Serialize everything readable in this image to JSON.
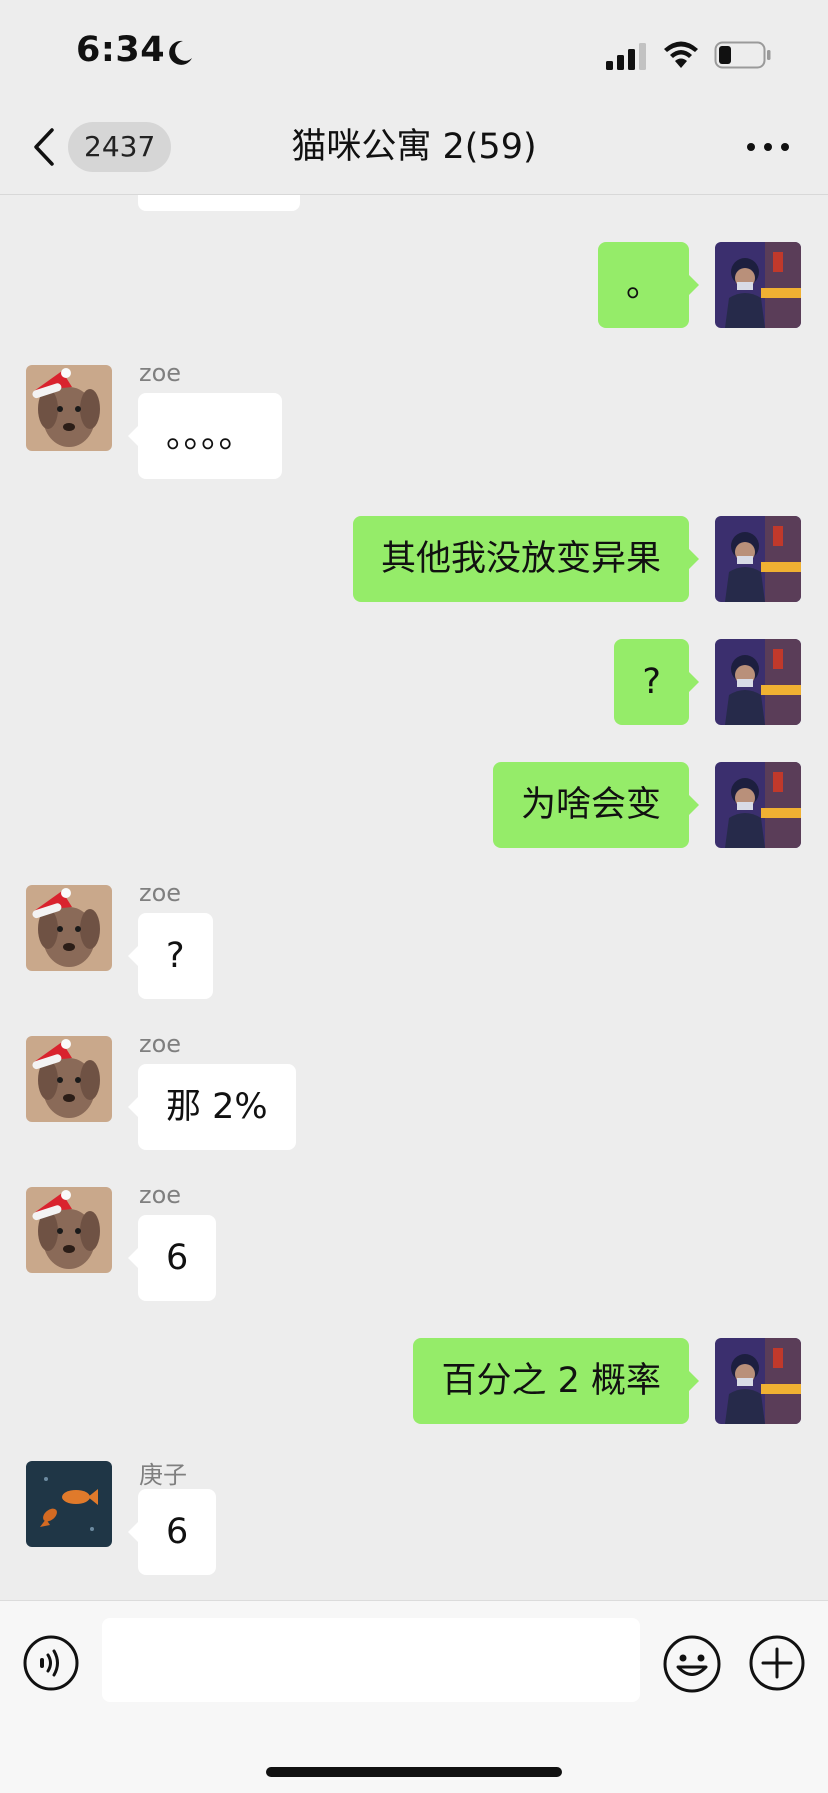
{
  "status_bar": {
    "time": "6:34"
  },
  "nav": {
    "unread_count": "2437",
    "title": "猫咪公寓 2(59)"
  },
  "messages": [
    {
      "side": "out",
      "text": "。"
    },
    {
      "side": "in",
      "sender": "zoe",
      "text": "。。。。"
    },
    {
      "side": "out",
      "text": "其他我没放变异果"
    },
    {
      "side": "out",
      "text": "?"
    },
    {
      "side": "out",
      "text": "为啥会变"
    },
    {
      "side": "in",
      "sender": "zoe",
      "text": "?"
    },
    {
      "side": "in",
      "sender": "zoe",
      "text": "那 2%"
    },
    {
      "side": "in",
      "sender": "zoe",
      "text": "6"
    },
    {
      "side": "out",
      "text": "百分之 2 概率"
    },
    {
      "side": "in",
      "sender": "庚子",
      "text": "6"
    }
  ],
  "input": {
    "value": ""
  },
  "colors": {
    "outgoing_bubble": "#95ec69",
    "incoming_bubble": "#ffffff",
    "background": "#ededed"
  },
  "icons": [
    "moon-icon",
    "signal-icon",
    "wifi-icon",
    "battery-icon",
    "back-icon",
    "more-icon",
    "voice-icon",
    "emoji-icon",
    "plus-icon"
  ]
}
